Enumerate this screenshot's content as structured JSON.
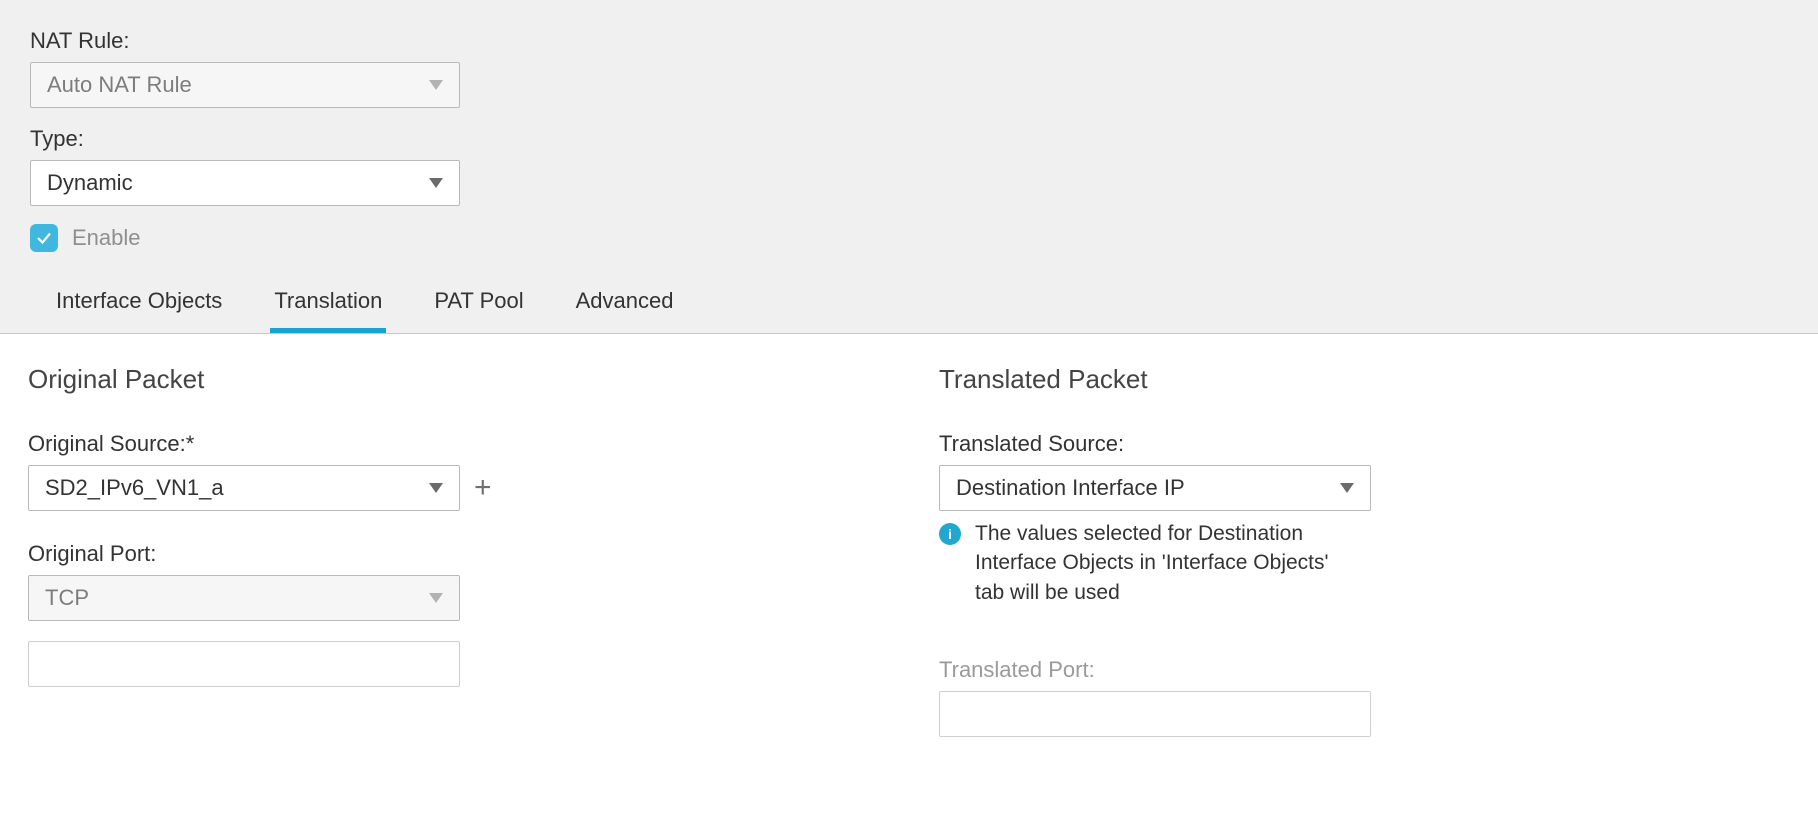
{
  "nat_rule": {
    "label": "NAT Rule:",
    "value": "Auto NAT Rule"
  },
  "type": {
    "label": "Type:",
    "value": "Dynamic"
  },
  "enable": {
    "label": "Enable",
    "checked": true
  },
  "tabs": {
    "interface_objects": "Interface Objects",
    "translation": "Translation",
    "pat_pool": "PAT Pool",
    "advanced": "Advanced",
    "active": "translation"
  },
  "original": {
    "title": "Original Packet",
    "source_label": "Original Source:*",
    "source_value": "SD2_IPv6_VN1_a",
    "port_label": "Original Port:",
    "port_value": "TCP"
  },
  "translated": {
    "title": "Translated Packet",
    "source_label": "Translated Source:",
    "source_value": "Destination Interface IP",
    "info_text": "The values selected for Destination Interface Objects in 'Interface Objects' tab will be used",
    "port_label": "Translated Port:"
  }
}
